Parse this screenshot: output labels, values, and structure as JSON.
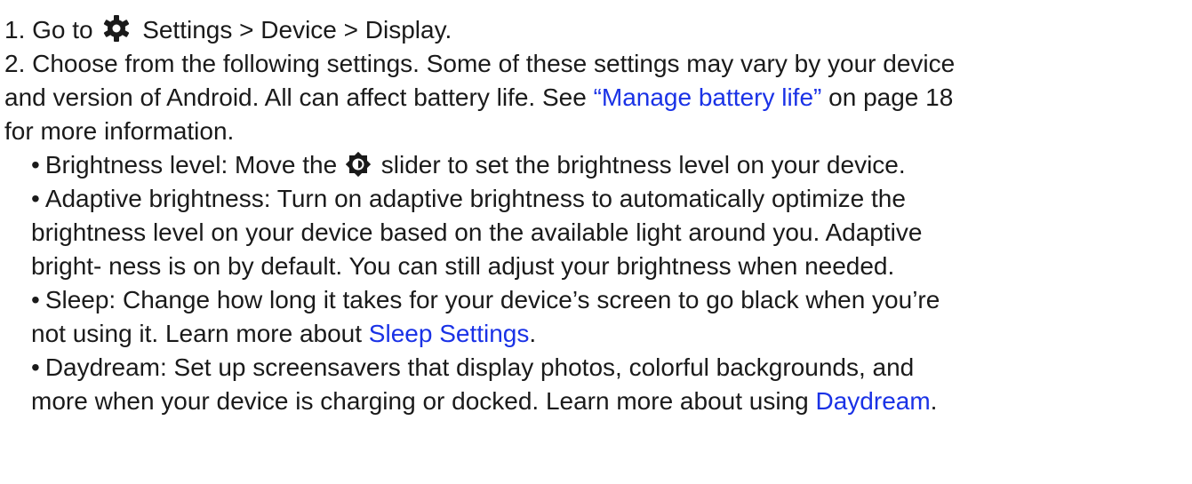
{
  "steps": {
    "step1": {
      "number": "1.",
      "go_to": "Go to",
      "path": "Settings > Device > Display."
    },
    "step2": {
      "number": "2.",
      "line1": "Choose from the following settings. Some of these settings may vary by your device",
      "line2_pre": "and version of Android. All can affect battery life. See",
      "line2_link": "“Manage battery life”",
      "line2_post": "on page 18",
      "line3": "for more information."
    }
  },
  "settings": {
    "brightness": {
      "bullet": "•",
      "pre": "Brightness level: Move the",
      "post": "slider to set the brightness level on your device."
    },
    "adaptive": {
      "bullet": "•",
      "line1": "Adaptive brightness: Turn on adaptive brightness to automatically optimize the",
      "line2": "brightness level on your device based on the available light around you. Adaptive",
      "line3": "bright- ness is on by default. You can still adjust your brightness when needed."
    },
    "sleep": {
      "bullet": "•",
      "line1": "Sleep: Change how long it takes for your device’s screen to go black when you’re",
      "line2_pre": "not using it. Learn more about",
      "line2_link": "Sleep Settings",
      "line2_post": "."
    },
    "daydream": {
      "bullet": "•",
      "line1": "Daydream: Set up screensavers that display photos, colorful backgrounds, and",
      "line2_pre": "more when your device is charging or docked. Learn more about using",
      "line2_link": "Daydream",
      "line2_post": "."
    }
  },
  "icons": {
    "settings": "settings-gear-icon",
    "brightness": "brightness-icon"
  },
  "colors": {
    "text": "#1a1a1a",
    "link": "#1a32e6"
  }
}
